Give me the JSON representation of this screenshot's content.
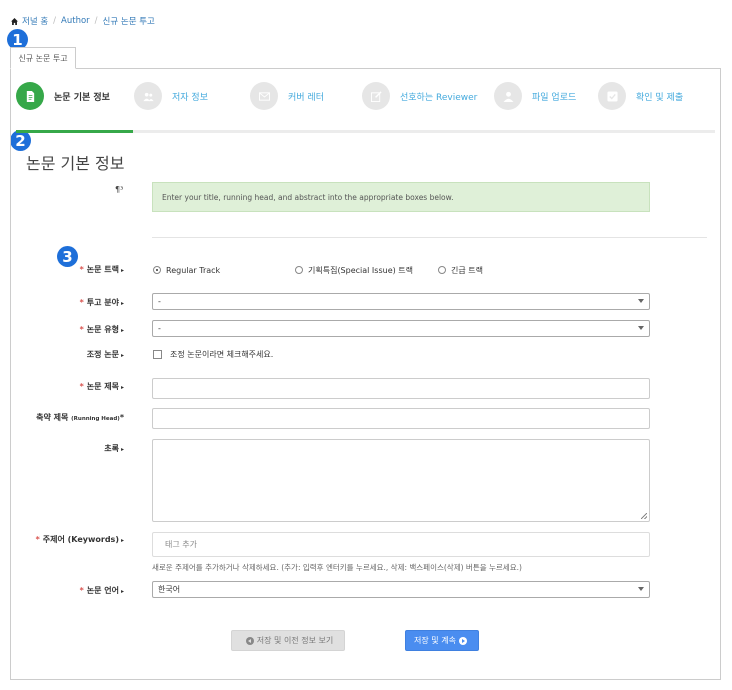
{
  "breadcrumb": {
    "home": "저널 홈",
    "author": "Author",
    "current": "신규 논문 투고"
  },
  "badges": [
    "1",
    "2",
    "3"
  ],
  "outer_tab": "신규 논문 투고",
  "steps": [
    {
      "label": "논문 기본 정보",
      "icon": "document-icon",
      "active": true
    },
    {
      "label": "저자 정보",
      "icon": "users-icon",
      "active": false
    },
    {
      "label": "커버 레터",
      "icon": "envelope-icon",
      "active": false
    },
    {
      "label": "선호하는 Reviewer",
      "icon": "edit-icon",
      "active": false
    },
    {
      "label": "파일 업로드",
      "icon": "user-upload-icon",
      "active": false
    },
    {
      "label": "확인 및 제출",
      "icon": "check-square-icon",
      "active": false
    }
  ],
  "progress": {
    "fraction": 0.1667,
    "color": "#36a849"
  },
  "section": {
    "title": "논문 기본 정보",
    "info_icon": "¶³",
    "alert": "Enter your title, running head, and abstract into the appropriate boxes below."
  },
  "form": {
    "track": {
      "label": "논문 트랙",
      "options": [
        "Regular Track",
        "기획특집(Special Issue) 트랙",
        "긴급 트랙"
      ],
      "selected": "Regular Track"
    },
    "field": {
      "label": "투고 분야",
      "value": "-"
    },
    "type": {
      "label": "논문 유형",
      "value": "-"
    },
    "revised": {
      "label": "조정 논문",
      "checkbox_label": "조정 논문이라면 체크해주세요."
    },
    "title": {
      "label": "논문 제목",
      "value": ""
    },
    "running_head": {
      "label": "축약 제목",
      "sub": "(Running Head)",
      "value": ""
    },
    "abstract": {
      "label": "초록",
      "value": ""
    },
    "keywords": {
      "label": "주제어 (Keywords)",
      "placeholder": "태그 추가",
      "help": "새로운 주제어를 추가하거나 삭제하세요. (추가: 입력후 엔터키를 누르세요., 삭제: 백스페이스(삭제) 버튼을 누르세요.)"
    },
    "language": {
      "label": "논문 언어",
      "value": "한국어"
    }
  },
  "buttons": {
    "prev": "저장 및 이전 정보 보기",
    "next": "저장 및 계속"
  },
  "colors": {
    "accent": "#36a849",
    "link": "#337ab7",
    "primary_button": "#4a8df0",
    "badge": "#1e6fd9",
    "required": "#d9534f"
  }
}
